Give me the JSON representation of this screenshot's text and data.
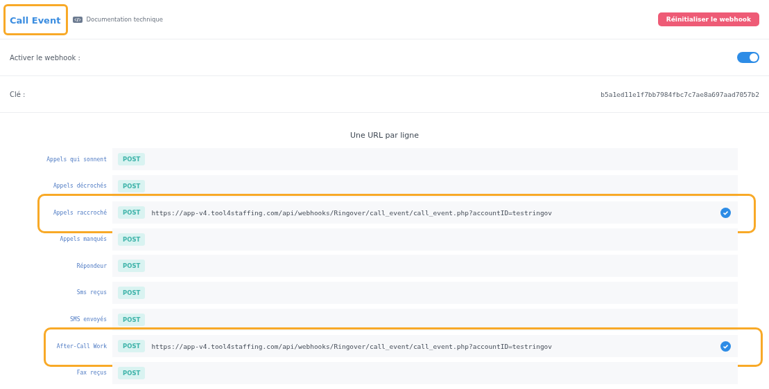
{
  "header": {
    "title": "Call Event",
    "title_highlighted": true,
    "doc_link": "Documentation technique",
    "reset_button": "Réinitialiser le webhook"
  },
  "settings": [
    {
      "kind": "toggle",
      "label": "Activer le webhook :",
      "on": true
    },
    {
      "kind": "text",
      "label": "Clé :",
      "value": "b5a1ed11e1f7bb7984fbc7c7ae8a697aad7057b2"
    }
  ],
  "urls": {
    "heading": "Une URL par ligne",
    "rows": [
      {
        "label": "Appels qui sonnent",
        "method": "POST",
        "highlighted": false,
        "verified": false
      },
      {
        "label": "Appels décrochés",
        "method": "POST",
        "highlighted": false,
        "verified": false
      },
      {
        "label": "Appels raccroché",
        "method": "POST",
        "url": "https://app-v4.tool4staffing.com/api/webhooks/Ringover/call_event/call_event.php?accountID=testringov",
        "highlighted": true,
        "verified": true
      },
      {
        "label": "Appels manqués",
        "method": "POST",
        "highlighted": false,
        "verified": false
      },
      {
        "label": "Répondeur",
        "method": "POST",
        "highlighted": false,
        "verified": false
      },
      {
        "label": "Sms reçus",
        "method": "POST",
        "highlighted": false,
        "verified": false
      },
      {
        "label": "SMS envoyés",
        "method": "POST",
        "highlighted": false,
        "verified": false
      },
      {
        "label": "After-Call Work",
        "method": "POST",
        "url": "https://app-v4.tool4staffing.com/api/webhooks/Ringover/call_event/call_event.php?accountID=testringov",
        "highlighted": true,
        "verified": true
      },
      {
        "label": "Fax reçus",
        "method": "POST",
        "highlighted": false,
        "verified": false
      }
    ]
  }
}
